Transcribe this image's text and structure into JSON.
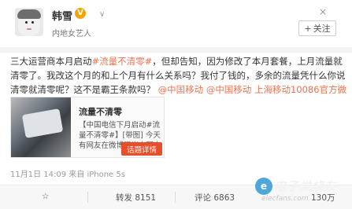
{
  "header": {
    "username": "韩雪",
    "verified_symbol": "V",
    "dropdown_symbol": "∨",
    "subtitle": "内地女艺人",
    "follow_label": "关注",
    "follow_plus": "+",
    "close_symbol": "×"
  },
  "post": {
    "t1": "三大运营商本月启动",
    "l1": "#流量不清零#",
    "t2": "，但却告知，因为修改了本月套餐，上月流量就清零了。我改这个月的和上个月有什么关系吗？我付了钱的，多余的流量凭什么你说清零就清零呢？这不是",
    "b1": "霸王条款",
    "t3": "吗？",
    "l2": "@中国移动",
    "l3": "@中国移动",
    "l4": "上海移动10086官方微博",
    "s1": " ",
    "s2": " ",
    "s3": " "
  },
  "card": {
    "title": "流量不清零",
    "desc": "【中国电信下月启动#流量不清零#】[带图] 今天有网友在微博曝光中国电",
    "button": "话题详情"
  },
  "meta": "11月1日 14:09 来自 iPhone 5s",
  "actions": {
    "favorite_icon": "☆",
    "repost": "转发 8151",
    "comment": "评论 6863",
    "like_count": "130万"
  },
  "watermark": {
    "logo": "e",
    "text": "电子发烧友",
    "sub": "elecfans.com"
  }
}
